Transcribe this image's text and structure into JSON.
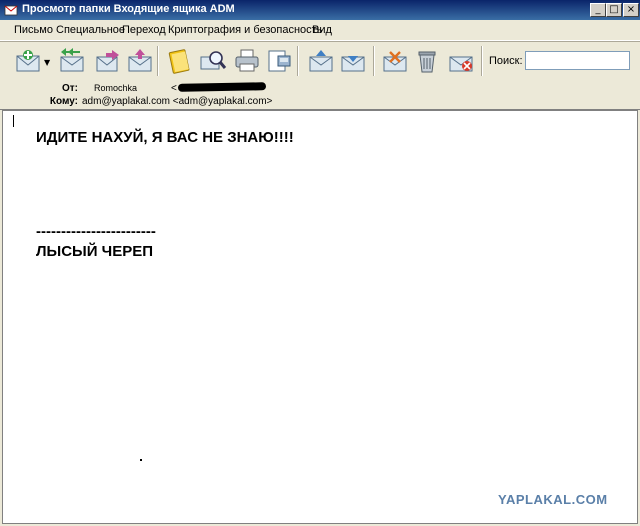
{
  "window": {
    "title": "Просмотр папки Входящие ящика ADM",
    "minimize_glyph": "_",
    "maximize_glyph": "□",
    "close_glyph": "×"
  },
  "menu": [
    {
      "name": "menu-letter",
      "label": "Письмо"
    },
    {
      "name": "menu-special",
      "label": "Специальное"
    },
    {
      "name": "menu-go",
      "label": "Переход"
    },
    {
      "name": "menu-crypto",
      "label": "Криптография и безопасность"
    },
    {
      "name": "menu-view",
      "label": "Вид"
    }
  ],
  "toolbar": {
    "dropdown_glyph": "▼",
    "search_label": "Поиск:",
    "search_value": "",
    "icons": [
      "new-mail-icon",
      "reply-all-icon",
      "forward-icon",
      "send-icon",
      "address-book-icon",
      "search-mail-icon",
      "print-icon",
      "print-preview-icon",
      "prev-message-icon",
      "next-message-icon",
      "mark-read-icon",
      "delete-icon",
      "junk-icon"
    ]
  },
  "header": {
    "from_label": "От:",
    "from_name": "Romochka",
    "from_bracket": "<",
    "to_label": "Кому:",
    "to_value": "adm@yaplakal.com <adm@yaplakal.com>"
  },
  "message": {
    "line1": "ИДИТЕ НАХУЙ, Я ВАС НЕ ЗНАЮ!!!!",
    "separator": "------------------------",
    "signature": "ЛЫСЫЙ ЧЕРЕП"
  },
  "watermark": "YAPLAKAL.COM",
  "colors": {
    "titlebar": "#0a246a",
    "watermark": "#5a7fa8"
  }
}
